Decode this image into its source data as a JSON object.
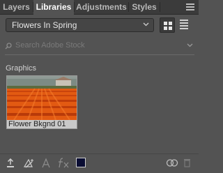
{
  "tabs": [
    {
      "label": "Layers",
      "active": false
    },
    {
      "label": "Libraries",
      "active": true
    },
    {
      "label": "Adjustments",
      "active": false
    },
    {
      "label": "Styles",
      "active": false
    }
  ],
  "library": {
    "selected": "Flowers In Spring"
  },
  "view": {
    "mode": "grid"
  },
  "search": {
    "placeholder": "Search Adobe Stock"
  },
  "graphics": {
    "title": "Graphics",
    "items": [
      {
        "label": "Flower Bkgnd 01"
      }
    ]
  },
  "toolbar": {
    "icons": [
      "upload-icon",
      "add-content-icon",
      "text-style-icon",
      "layer-style-icon",
      "foreground-color-swatch",
      "creative-cloud-icon",
      "trash-icon"
    ],
    "swatch_color": "#0a0d33"
  },
  "colors": {
    "panel": "#535353",
    "tabbar": "#3b3b3b",
    "text": "#dcdcdc"
  }
}
